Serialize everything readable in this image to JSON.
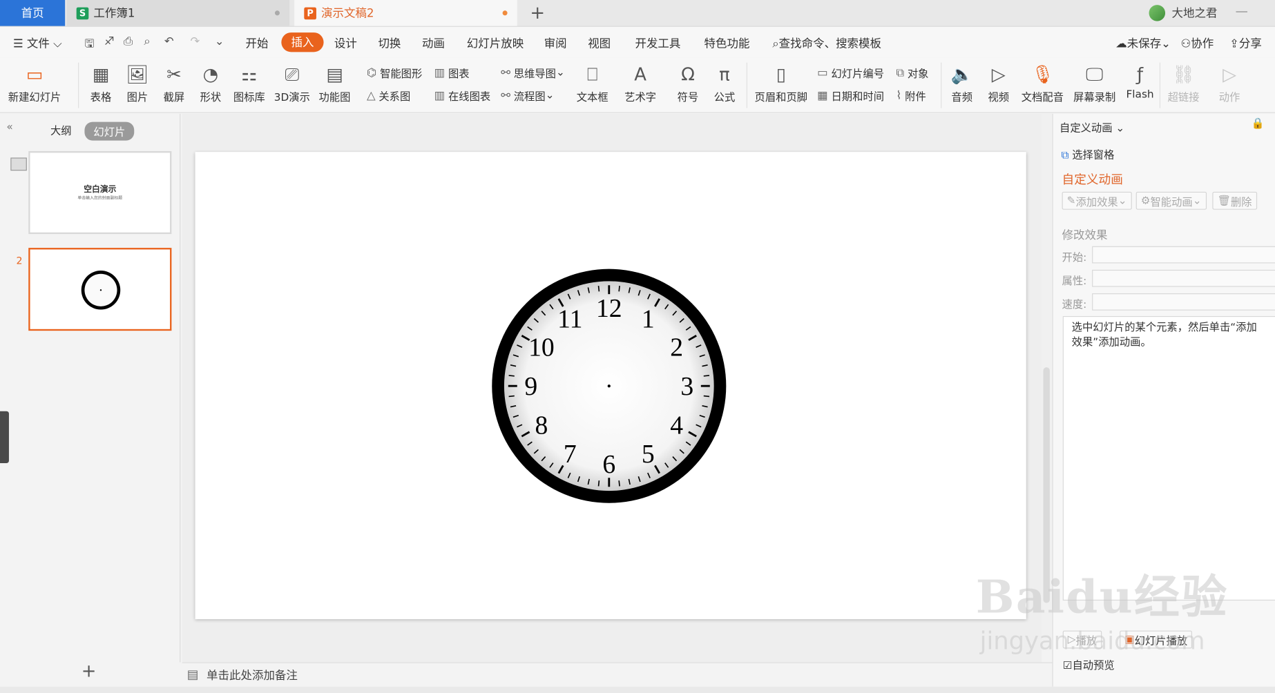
{
  "tabs": {
    "home": "首页",
    "workbook": "工作簿1",
    "presentation": "演示文稿2"
  },
  "user": {
    "name": "大地之君"
  },
  "menu": {
    "file": "文件",
    "items": [
      "开始",
      "插入",
      "设计",
      "切换",
      "动画",
      "幻灯片放映",
      "审阅",
      "视图",
      "开发工具",
      "特色功能"
    ],
    "search": "查找命令、搜索模板",
    "unsaved": "未保存",
    "collab": "协作",
    "share": "分享"
  },
  "ribbon": {
    "new_slide": "新建幻灯片",
    "table": "表格",
    "picture": "图片",
    "screenshot": "截屏",
    "shape": "形状",
    "icon_lib": "图标库",
    "demo3d": "3D演示",
    "func": "功能图",
    "smartart": "智能图形",
    "chart": "图表",
    "relation": "关系图",
    "online_chart": "在线图表",
    "mindmap": "思维导图",
    "flowchart": "流程图",
    "textbox": "文本框",
    "wordart": "艺术字",
    "symbol": "符号",
    "formula": "公式",
    "header_footer": "页眉和页脚",
    "slide_no": "幻灯片编号",
    "object": "对象",
    "datetime": "日期和时间",
    "attach": "附件",
    "audio": "音频",
    "video": "视频",
    "doc_voice": "文档配音",
    "screen_rec": "屏幕录制",
    "flash": "Flash",
    "hyperlink": "超链接",
    "action": "动作"
  },
  "left": {
    "outline": "大纲",
    "slides": "幻灯片",
    "slide1_title": "空白演示",
    "slide1_sub": "单击输入您的封面副标题",
    "slide2_num": "2"
  },
  "clock": {
    "numbers": [
      "12",
      "1",
      "2",
      "3",
      "4",
      "5",
      "6",
      "7",
      "8",
      "9",
      "10",
      "11"
    ]
  },
  "notes": {
    "placeholder": "单击此处添加备注"
  },
  "right": {
    "header": "自定义动画",
    "select_pane": "选择窗格",
    "title": "自定义动画",
    "add_effect": "添加效果",
    "smart_anim": "智能动画",
    "delete": "删除",
    "modify": "修改效果",
    "start": "开始:",
    "prop": "属性:",
    "speed": "速度:",
    "hint": "选中幻灯片的某个元素，然后单击“添加效果”添加动画。",
    "play": "播放",
    "slideshow": "幻灯片播放",
    "autopreview": "自动预览"
  },
  "watermark": {
    "main": "Baidu经验",
    "sub": "jingyan.baidu.com"
  }
}
